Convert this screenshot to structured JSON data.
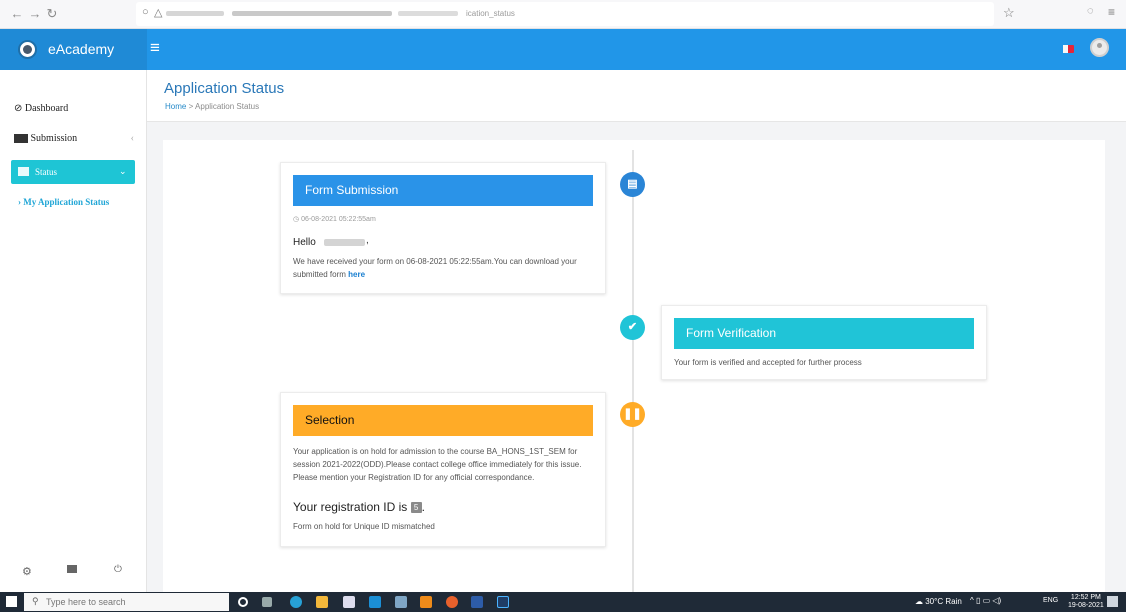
{
  "browser": {
    "url_suffix": "ication_status"
  },
  "header": {
    "brand": "eAcademy",
    "hamburger_icon": "hamburger-icon"
  },
  "sidebar": {
    "items": [
      {
        "label": "Dashboard",
        "icon": "dashboard-icon"
      },
      {
        "label": "Submission",
        "icon": "submission-icon"
      },
      {
        "label": "Status",
        "icon": "status-icon"
      }
    ],
    "sub_item": "› My Application Status"
  },
  "page": {
    "title": "Application Status",
    "breadcrumb_home": "Home",
    "breadcrumb_sep": ">",
    "breadcrumb_current": "Application Status"
  },
  "timeline": {
    "form_submission": {
      "title": "Form Submission",
      "date": "06-08-2021 05:22:55am",
      "hello": "Hello",
      "message": "We have received your form on 06-08-2021 05:22:55am.You can download your submitted form",
      "link": "here"
    },
    "form_verification": {
      "title": "Form Verification",
      "message": "Your form is verified and accepted for further process"
    },
    "selection": {
      "title": "Selection",
      "message": "Your application is on hold for admission to the course BA_HONS_1ST_SEM for session 2021-2022(ODD).Please contact college office immediately for this issue. Please mention your Registration ID for any official correspondance.",
      "reg_label": "Your registration ID is",
      "reg_id": "5",
      "note": "Form on hold for Unique ID mismatched"
    }
  },
  "taskbar": {
    "search_placeholder": "Type here to search",
    "weather": "30°C Rain",
    "lang": "ENG",
    "time": "12:52 PM",
    "date": "19-08-2021"
  },
  "colors": {
    "header": "#2196e8",
    "submission": "#2a93e8",
    "verification": "#20c4d7",
    "selection": "#ffab27"
  }
}
